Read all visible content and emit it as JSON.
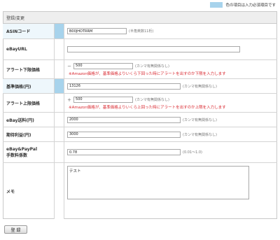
{
  "legend": {
    "text": "色の項目は入力必須項目です",
    "color": "#a7d3ec"
  },
  "panel": {
    "title": "登録/変更"
  },
  "form": {
    "asin": {
      "label": "ASINコード",
      "value": "B00JHOTRRM",
      "hint": "(半角英数11桁)"
    },
    "ebay_url": {
      "label": "eBayURL",
      "value": ""
    },
    "alert_lower": {
      "label": "アラート下限価格",
      "prefix": "－",
      "value": "500",
      "hint": "(カンマ有無関係なし)",
      "warning": "※Amazon価格が、基準価格よりいくら下回った時にアラートを出すのか下限を入力します"
    },
    "base_price": {
      "label": "基準価格(円)",
      "value": "13126",
      "hint": "(カンマ有無関係なし)"
    },
    "alert_upper": {
      "label": "アラート上限価格",
      "prefix": "＋",
      "value": "500",
      "hint": "(カンマ有無関係なし)",
      "warning": "※Amazon価格が、基準価格よりいくら上回った時にアラートを出すのか上限を入力します"
    },
    "ebay_shipping": {
      "label": "eBay送料(円)",
      "value": "2000",
      "hint": "(カンマ有無関係なし)"
    },
    "expected_profit": {
      "label": "期待利益(円)",
      "value": "3000",
      "hint": "(カンマ有無関係なし)"
    },
    "fee_rate": {
      "label_line1": "eBay&PayPal",
      "label_line2": "手数料係数",
      "value": "0.78",
      "hint": "(0.01〜1.0)"
    },
    "memo": {
      "label": "メモ",
      "value": "テスト"
    }
  },
  "submit_label": "登 録"
}
